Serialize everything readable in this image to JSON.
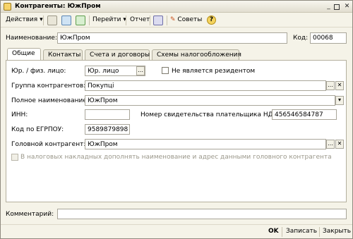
{
  "window": {
    "title": "Контрагенты: ЮжПром"
  },
  "toolbar": {
    "actions_label": "Действия",
    "goto_label": "Перейти",
    "report_label": "Отчет",
    "tips_label": "Советы",
    "help_glyph": "?"
  },
  "form": {
    "name_label": "Наименование:",
    "name_value": "ЮжПром",
    "code_label": "Код:",
    "code_value": "00068"
  },
  "tabs": [
    {
      "label": "Общие"
    },
    {
      "label": "Контакты"
    },
    {
      "label": "Счета и договоры"
    },
    {
      "label": "Схемы налогообложения"
    }
  ],
  "general": {
    "legal_type_label": "Юр. / физ. лицо:",
    "legal_type_value": "Юр. лицо",
    "nonresident_label": "Не является резидентом",
    "group_label": "Группа контрагентов:",
    "group_value": "Покупці",
    "fullname_label": "Полное наименование:",
    "fullname_value": "ЮжПром",
    "inn_label": "ИНН:",
    "inn_value": "",
    "vat_cert_label": "Номер свидетельства плательщика НДС:",
    "vat_cert_value": "456546584787",
    "egrpou_label": "Код по ЕГРПОУ:",
    "egrpou_value": "9589879898",
    "parent_label": "Головной контрагент:",
    "parent_value": "ЮжПром",
    "invoice_note_label": "В налоговых накладных дополнять наименование и адрес  данными головного контрагента"
  },
  "comment": {
    "label": "Комментарий:",
    "value": ""
  },
  "footer": {
    "ok_label": "OK",
    "save_label": "Записать",
    "close_label": "Закрыть"
  }
}
